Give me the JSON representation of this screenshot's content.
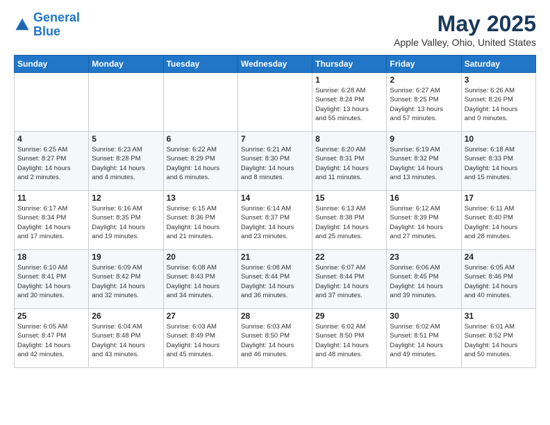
{
  "header": {
    "logo_line1": "General",
    "logo_line2": "Blue",
    "title": "May 2025",
    "subtitle": "Apple Valley, Ohio, United States"
  },
  "weekdays": [
    "Sunday",
    "Monday",
    "Tuesday",
    "Wednesday",
    "Thursday",
    "Friday",
    "Saturday"
  ],
  "weeks": [
    [
      {
        "day": "",
        "info": ""
      },
      {
        "day": "",
        "info": ""
      },
      {
        "day": "",
        "info": ""
      },
      {
        "day": "",
        "info": ""
      },
      {
        "day": "1",
        "info": "Sunrise: 6:28 AM\nSunset: 8:24 PM\nDaylight: 13 hours\nand 55 minutes."
      },
      {
        "day": "2",
        "info": "Sunrise: 6:27 AM\nSunset: 8:25 PM\nDaylight: 13 hours\nand 57 minutes."
      },
      {
        "day": "3",
        "info": "Sunrise: 6:26 AM\nSunset: 8:26 PM\nDaylight: 14 hours\nand 0 minutes."
      }
    ],
    [
      {
        "day": "4",
        "info": "Sunrise: 6:25 AM\nSunset: 8:27 PM\nDaylight: 14 hours\nand 2 minutes."
      },
      {
        "day": "5",
        "info": "Sunrise: 6:23 AM\nSunset: 8:28 PM\nDaylight: 14 hours\nand 4 minutes."
      },
      {
        "day": "6",
        "info": "Sunrise: 6:22 AM\nSunset: 8:29 PM\nDaylight: 14 hours\nand 6 minutes."
      },
      {
        "day": "7",
        "info": "Sunrise: 6:21 AM\nSunset: 8:30 PM\nDaylight: 14 hours\nand 8 minutes."
      },
      {
        "day": "8",
        "info": "Sunrise: 6:20 AM\nSunset: 8:31 PM\nDaylight: 14 hours\nand 11 minutes."
      },
      {
        "day": "9",
        "info": "Sunrise: 6:19 AM\nSunset: 8:32 PM\nDaylight: 14 hours\nand 13 minutes."
      },
      {
        "day": "10",
        "info": "Sunrise: 6:18 AM\nSunset: 8:33 PM\nDaylight: 14 hours\nand 15 minutes."
      }
    ],
    [
      {
        "day": "11",
        "info": "Sunrise: 6:17 AM\nSunset: 8:34 PM\nDaylight: 14 hours\nand 17 minutes."
      },
      {
        "day": "12",
        "info": "Sunrise: 6:16 AM\nSunset: 8:35 PM\nDaylight: 14 hours\nand 19 minutes."
      },
      {
        "day": "13",
        "info": "Sunrise: 6:15 AM\nSunset: 8:36 PM\nDaylight: 14 hours\nand 21 minutes."
      },
      {
        "day": "14",
        "info": "Sunrise: 6:14 AM\nSunset: 8:37 PM\nDaylight: 14 hours\nand 23 minutes."
      },
      {
        "day": "15",
        "info": "Sunrise: 6:13 AM\nSunset: 8:38 PM\nDaylight: 14 hours\nand 25 minutes."
      },
      {
        "day": "16",
        "info": "Sunrise: 6:12 AM\nSunset: 8:39 PM\nDaylight: 14 hours\nand 27 minutes."
      },
      {
        "day": "17",
        "info": "Sunrise: 6:11 AM\nSunset: 8:40 PM\nDaylight: 14 hours\nand 28 minutes."
      }
    ],
    [
      {
        "day": "18",
        "info": "Sunrise: 6:10 AM\nSunset: 8:41 PM\nDaylight: 14 hours\nand 30 minutes."
      },
      {
        "day": "19",
        "info": "Sunrise: 6:09 AM\nSunset: 8:42 PM\nDaylight: 14 hours\nand 32 minutes."
      },
      {
        "day": "20",
        "info": "Sunrise: 6:08 AM\nSunset: 8:43 PM\nDaylight: 14 hours\nand 34 minutes."
      },
      {
        "day": "21",
        "info": "Sunrise: 6:08 AM\nSunset: 8:44 PM\nDaylight: 14 hours\nand 36 minutes."
      },
      {
        "day": "22",
        "info": "Sunrise: 6:07 AM\nSunset: 8:44 PM\nDaylight: 14 hours\nand 37 minutes."
      },
      {
        "day": "23",
        "info": "Sunrise: 6:06 AM\nSunset: 8:45 PM\nDaylight: 14 hours\nand 39 minutes."
      },
      {
        "day": "24",
        "info": "Sunrise: 6:05 AM\nSunset: 8:46 PM\nDaylight: 14 hours\nand 40 minutes."
      }
    ],
    [
      {
        "day": "25",
        "info": "Sunrise: 6:05 AM\nSunset: 8:47 PM\nDaylight: 14 hours\nand 42 minutes."
      },
      {
        "day": "26",
        "info": "Sunrise: 6:04 AM\nSunset: 8:48 PM\nDaylight: 14 hours\nand 43 minutes."
      },
      {
        "day": "27",
        "info": "Sunrise: 6:03 AM\nSunset: 8:49 PM\nDaylight: 14 hours\nand 45 minutes."
      },
      {
        "day": "28",
        "info": "Sunrise: 6:03 AM\nSunset: 8:50 PM\nDaylight: 14 hours\nand 46 minutes."
      },
      {
        "day": "29",
        "info": "Sunrise: 6:02 AM\nSunset: 8:50 PM\nDaylight: 14 hours\nand 48 minutes."
      },
      {
        "day": "30",
        "info": "Sunrise: 6:02 AM\nSunset: 8:51 PM\nDaylight: 14 hours\nand 49 minutes."
      },
      {
        "day": "31",
        "info": "Sunrise: 6:01 AM\nSunset: 8:52 PM\nDaylight: 14 hours\nand 50 minutes."
      }
    ]
  ]
}
